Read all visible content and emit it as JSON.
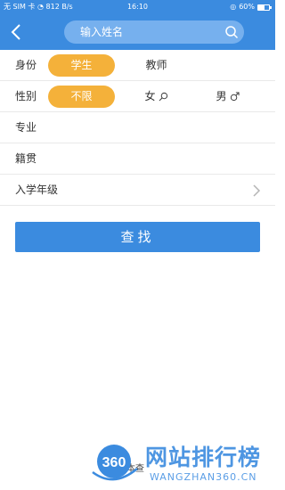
{
  "status_bar": {
    "carrier": "无 SIM 卡",
    "speed": "812 B/s",
    "time": "16:10",
    "battery": "60%",
    "battery_level": 0.6
  },
  "header": {
    "search_placeholder": "输入姓名"
  },
  "filters": {
    "identity_label": "身份",
    "identity_options": [
      "学生",
      "教师"
    ],
    "identity_selected": "学生",
    "gender_label": "性别",
    "gender_options": [
      "不限",
      "女",
      "男"
    ],
    "gender_selected": "不限",
    "major_label": "专业",
    "hometown_label": "籍贯",
    "enroll_year_label": "入学年级"
  },
  "actions": {
    "query_label": "查找"
  },
  "footer": {
    "note": "本查"
  },
  "watermark": {
    "logo_text": "360",
    "title": "网站排行榜",
    "subtitle": "WANGZHAN360.CN"
  },
  "colors": {
    "primary": "#3b8bdf",
    "accent": "#f4b13a"
  }
}
